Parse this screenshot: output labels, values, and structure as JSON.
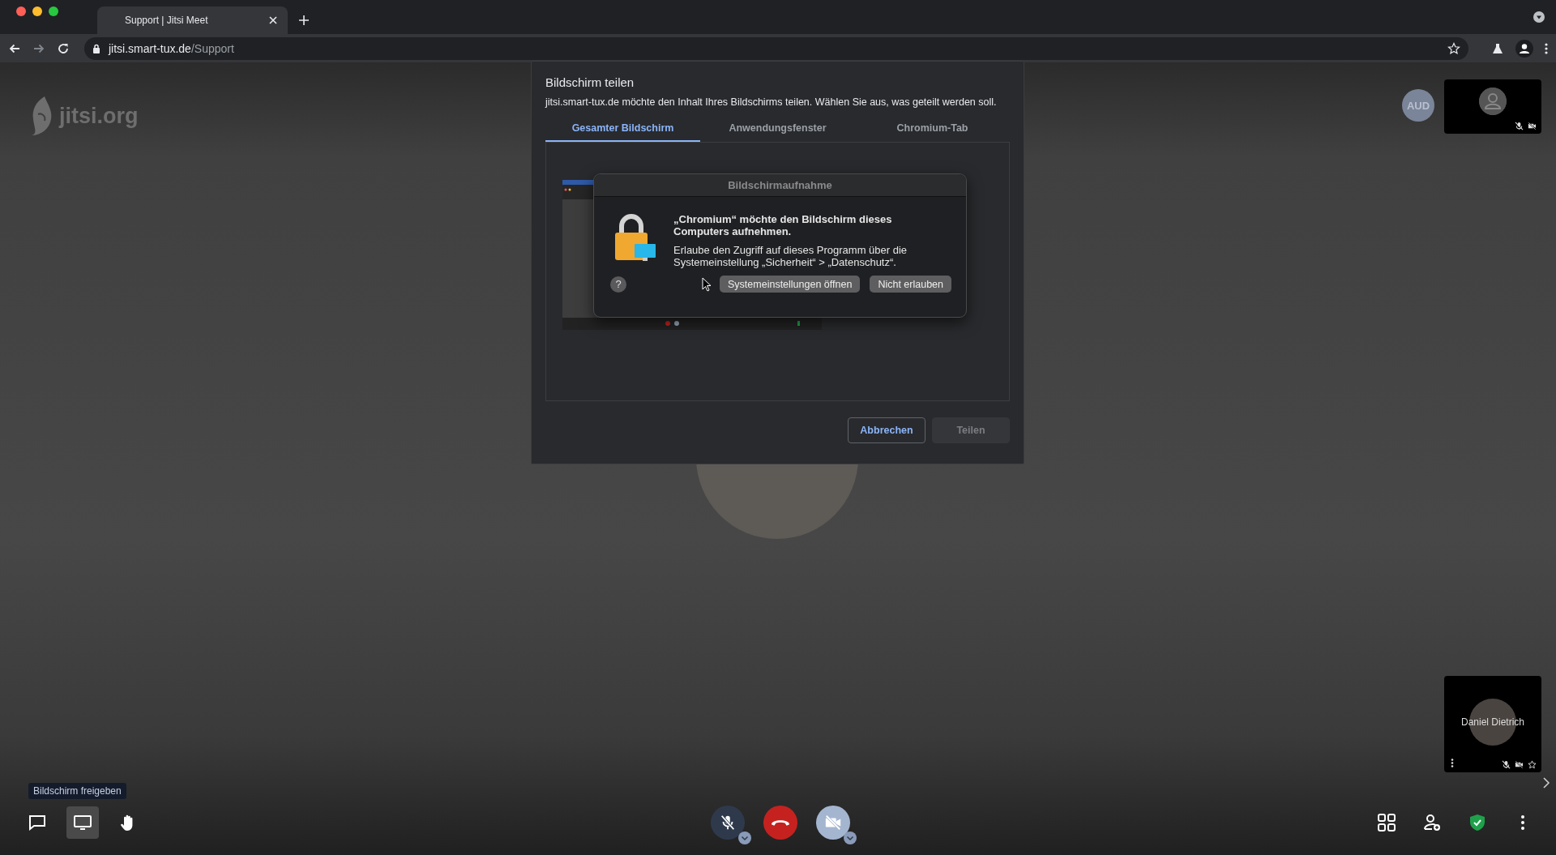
{
  "browser": {
    "tab": {
      "title": "Support | Jitsi Meet"
    },
    "url": {
      "host": "jitsi.smart-tux.de",
      "path": "/Support"
    }
  },
  "meeting": {
    "logo": "jitsi.org",
    "remote_thumbnail": {
      "initials": "AUD",
      "muted": true,
      "video_off": true
    },
    "local_thumbnail": {
      "name": "Daniel Dietrich",
      "muted": true,
      "video_off": true
    },
    "tooltip": "Bildschirm freigeben",
    "toolbar_left": [
      {
        "kind": "chat",
        "selected": false
      },
      {
        "kind": "screen",
        "selected": true
      },
      {
        "kind": "hand",
        "selected": false
      }
    ],
    "toolbar_center": [
      {
        "kind": "mic",
        "off": true
      },
      {
        "kind": "hangup"
      },
      {
        "kind": "camera",
        "off": true
      }
    ],
    "toolbar_right": [
      {
        "kind": "grid"
      },
      {
        "kind": "invite"
      },
      {
        "kind": "security"
      },
      {
        "kind": "more"
      }
    ]
  },
  "share_dialog": {
    "title": "Bildschirm teilen",
    "description": "jitsi.smart-tux.de möchte den Inhalt Ihres Bildschirms teilen. Wählen Sie aus, was geteilt werden soll.",
    "tabs": [
      {
        "label": "Gesamter Bildschirm",
        "selected": true
      },
      {
        "label": "Anwendungsfenster",
        "selected": false
      },
      {
        "label": "Chromium-Tab",
        "selected": false
      }
    ],
    "alert": {
      "title": "Bildschirmaufnahme",
      "heading": "„Chromium“ möchte den Bildschirm dieses Computers aufnehmen.",
      "body": "Erlaube den Zugriff auf dieses Programm über die Systemeinstellung „Sicherheit“ > „Datenschutz“.",
      "help": "?",
      "buttons": [
        "Systemeinstellungen öffnen",
        "Nicht erlauben"
      ]
    },
    "buttons": [
      {
        "label": "Abbrechen",
        "disabled": false
      },
      {
        "label": "Teilen",
        "disabled": true
      }
    ]
  }
}
